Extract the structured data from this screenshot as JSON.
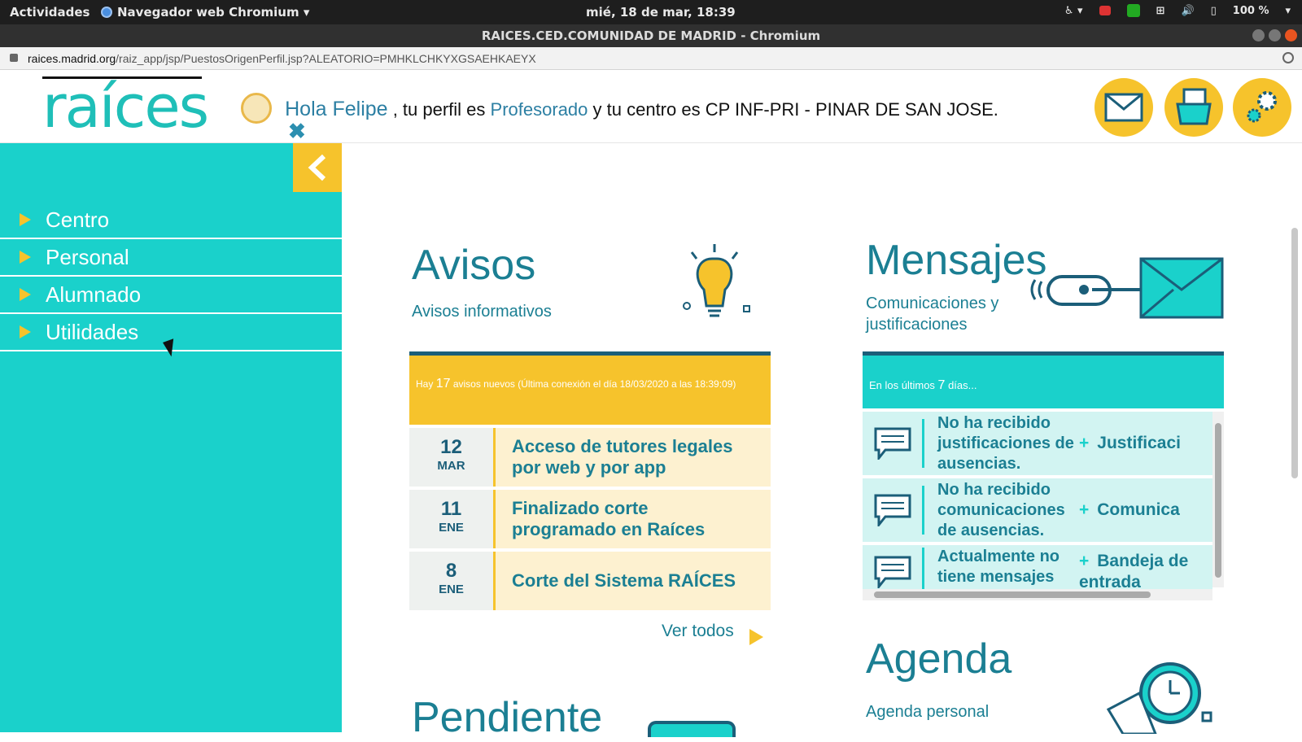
{
  "system_bar": {
    "activities": "Actividades",
    "app_name": "Navegador web Chromium",
    "clock": "mié, 18 de mar, 18:39",
    "battery": "100 %"
  },
  "window": {
    "title": "RAICES.CED.COMUNIDAD DE MADRID - Chromium"
  },
  "browser": {
    "url_domain": "raices.madrid.org",
    "url_path": "/raiz_app/jsp/PuestosOrigenPerfil.jsp?ALEATORIO=PMHKLCHKYXGSAEHKAEYX"
  },
  "header": {
    "logo": "raíces",
    "greeting": "Hola Felipe",
    "text1": ", tu perfil es",
    "profile": "Profesorado",
    "text2": "y tu centro es CP INF-PRI - PINAR DE SAN JOSE."
  },
  "sidebar": {
    "items": [
      {
        "label": "Centro"
      },
      {
        "label": "Personal"
      },
      {
        "label": "Alumnado"
      },
      {
        "label": "Utilidades"
      }
    ]
  },
  "avisos": {
    "title": "Avisos",
    "subtitle": "Avisos informativos",
    "band_pre": "Hay",
    "band_count": "17",
    "band_post": "avisos nuevos (Última conexión el día 18/03/2020 a las 18:39:09)",
    "items": [
      {
        "day": "12",
        "month": "MAR",
        "title": "Acceso de tutores legales por web y por app"
      },
      {
        "day": "11",
        "month": "ENE",
        "title": "Finalizado corte programado en Raíces"
      },
      {
        "day": "8",
        "month": "ENE",
        "title": "Corte del Sistema RAÍCES"
      }
    ],
    "see_all": "Ver todos"
  },
  "mensajes": {
    "title": "Mensajes",
    "subtitle": "Comunicaciones y justificaciones",
    "band_pre": "En los últimos",
    "band_count": "7",
    "band_post": "días...",
    "items": [
      {
        "text": "No ha recibido justificaciones de ausencias.",
        "link": "Justificaci"
      },
      {
        "text": "No ha recibido comunicaciones de ausencias.",
        "link": "Comunica"
      },
      {
        "text": "Actualmente no tiene mensajes sin leer",
        "link": "Bandeja de entrada"
      }
    ]
  },
  "agenda": {
    "title": "Agenda",
    "subtitle": "Agenda personal"
  },
  "pendiente": {
    "title": "Pendiente"
  },
  "colors": {
    "teal": "#1ad1cb",
    "yellow": "#f6c32c",
    "dark_teal": "#1b7f93",
    "navy": "#1b5e79"
  },
  "icons": [
    "accessibility-icon",
    "camera-icon",
    "shield-icon",
    "network-icon",
    "volume-icon",
    "battery-icon",
    "lock-icon",
    "zoom-icon",
    "user-icon",
    "close-icon",
    "mail-icon",
    "folder-icon",
    "gear-icon",
    "chevron-left-icon",
    "lightbulb-icon",
    "envelope-link-icon",
    "chat-icon",
    "clock-icon"
  ]
}
